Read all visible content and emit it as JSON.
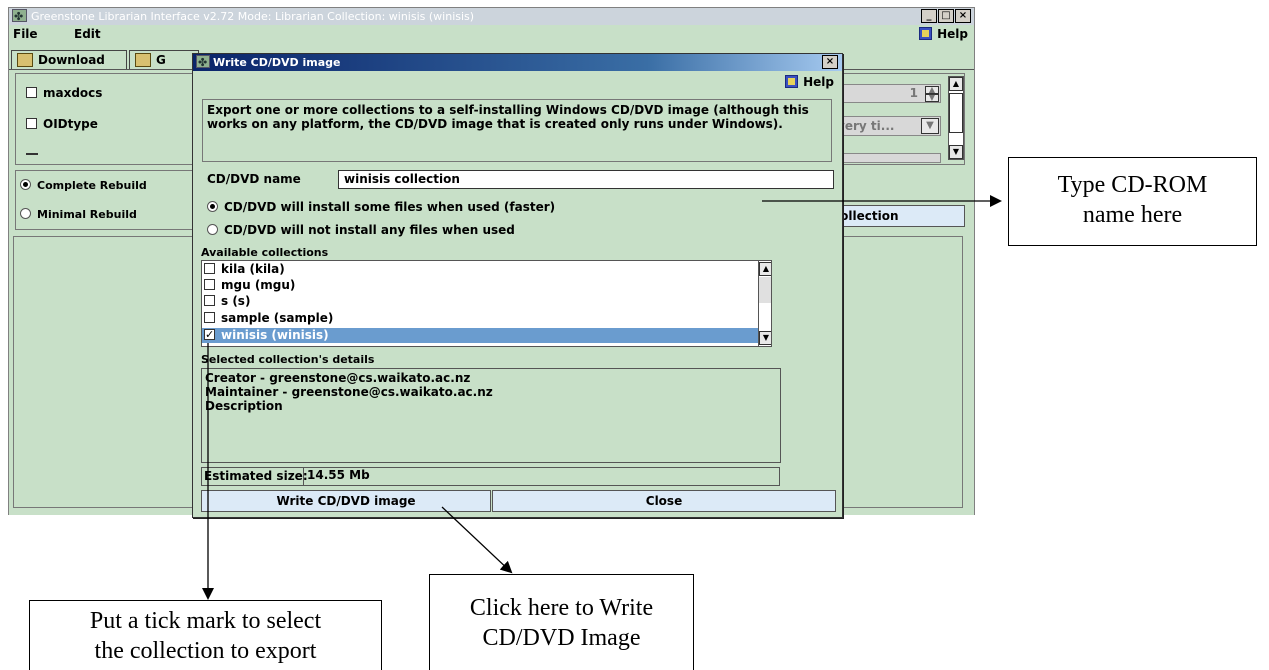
{
  "main_window": {
    "title": "Greenstone Librarian Interface v2.72  Mode: Librarian  Collection: winisis (winisis)",
    "controls": [
      "_",
      "□",
      "×"
    ],
    "menu": {
      "file": "File",
      "edit": "Edit",
      "help": "Help"
    },
    "tabs": [
      {
        "label": "Download",
        "icon": "download-icon"
      },
      {
        "label": "G",
        "icon": "gather-icon"
      }
    ],
    "options": {
      "maxdocs": "maxdocs",
      "oidtype": "OIDtype"
    },
    "spinner_value": "1",
    "combo_value": "ame every ti...",
    "rebuild": {
      "complete": "Complete Rebuild",
      "minimal": "Minimal Rebuild",
      "selected": "complete"
    },
    "preview_button": "view Collection"
  },
  "dialog": {
    "title": "Write CD/DVD image",
    "close": "×",
    "help": "Help",
    "description": "Export one or more collections to a self-installing Windows CD/DVD image (although this works on any platform, the CD/DVD image that is created only runs under Windows).",
    "cd_name_label": "CD/DVD name",
    "cd_name_value": "winisis collection",
    "install_option_some": "CD/DVD will install some files when used (faster)",
    "install_option_none": "CD/DVD will not install any files when used",
    "install_selected": "some",
    "available_label": "Available collections",
    "collections": [
      {
        "label": "kila  (kila)",
        "checked": false,
        "selected": false
      },
      {
        "label": "mgu (mgu)",
        "checked": false,
        "selected": false
      },
      {
        "label": "s (s)",
        "checked": false,
        "selected": false
      },
      {
        "label": "sample (sample)",
        "checked": false,
        "selected": false
      },
      {
        "label": "winisis (winisis)",
        "checked": true,
        "selected": true
      }
    ],
    "details_label": "Selected collection's details",
    "details": {
      "creator": "Creator - greenstone@cs.waikato.ac.nz",
      "maintainer": "Maintainer - greenstone@cs.waikato.ac.nz",
      "description": "Description"
    },
    "estimated_label": "Estimated size:",
    "estimated_value": "14.55 Mb",
    "write_button": "Write CD/DVD image",
    "close_button": "Close"
  },
  "annotations": {
    "cdrom_note": [
      "Type CD-ROM",
      "name here"
    ],
    "tick_note": [
      "Put a tick mark to select",
      "the collection to export"
    ],
    "write_note": [
      "Click here to Write",
      "CD/DVD Image"
    ]
  }
}
